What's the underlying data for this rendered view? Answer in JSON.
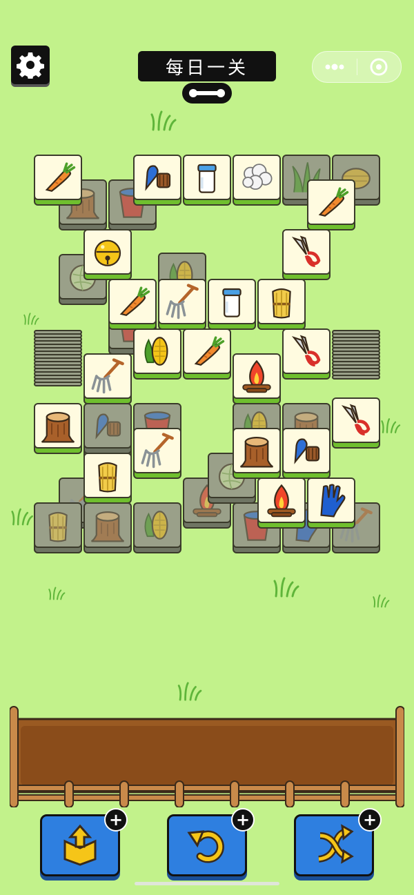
{
  "title": "每日一关",
  "icons": {
    "settings": "gear-icon",
    "more": "more-dots-icon",
    "close": "target-circle-icon",
    "handle": "bone-handle-icon"
  },
  "tile_types": [
    "carrot",
    "brush",
    "milk",
    "wool",
    "grass",
    "hay-bale",
    "bell",
    "shears",
    "pitchfork",
    "wheat",
    "corn",
    "campfire",
    "stump",
    "bucket",
    "glove",
    "cabbage"
  ],
  "board": {
    "active_tiles": [
      "carrot",
      "brush",
      "milk",
      "wool",
      "carrot",
      "bell",
      "shears",
      "carrot",
      "pitchfork",
      "milk",
      "wheat",
      "corn",
      "carrot",
      "shears",
      "pitchfork",
      "campfire",
      "stump",
      "stump",
      "pitchfork",
      "brush",
      "shears",
      "wheat",
      "campfire",
      "glove"
    ],
    "dim_tiles": [
      "hay-bale",
      "grass",
      "stump",
      "bucket",
      "cabbage",
      "corn",
      "bucket",
      "bucket",
      "wool",
      "brush",
      "corn",
      "bucket",
      "stump",
      "wheat",
      "pitchfork",
      "campfire",
      "cabbage",
      "wheat",
      "stump",
      "corn",
      "bucket",
      "glove",
      "pitchfork"
    ]
  },
  "buttons": [
    {
      "name": "shift-out-button",
      "icon": "box-up-arrow-icon",
      "plus": "+"
    },
    {
      "name": "undo-button",
      "icon": "undo-arrow-icon",
      "plus": "+"
    },
    {
      "name": "shuffle-button",
      "icon": "shuffle-arrows-icon",
      "plus": "+"
    }
  ],
  "colors": {
    "background": "#c2f28b",
    "tile_face": "#fffbe0",
    "tile_base": "#6fbf2e",
    "tile_dim": "#9aa089",
    "tray_wood": "#9a5a22",
    "button_blue": "#2e7fe0"
  }
}
